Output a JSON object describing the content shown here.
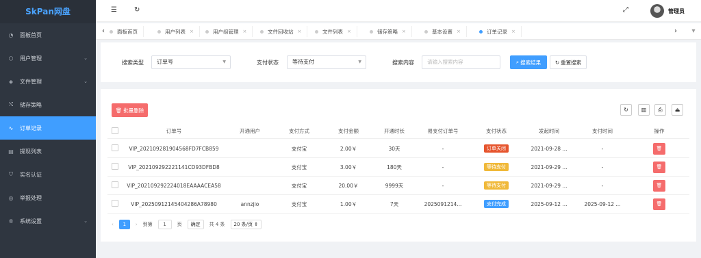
{
  "app": {
    "brand": "SkPan网盘"
  },
  "sidebar": {
    "items": [
      {
        "label": "面板首页",
        "icon": "◔",
        "chevron": ""
      },
      {
        "label": "用户管理",
        "icon": "⬡",
        "chevron": "⌄"
      },
      {
        "label": "文件管理",
        "icon": "◈",
        "chevron": "⌄"
      },
      {
        "label": "储存策略",
        "icon": "⤭",
        "chevron": ""
      },
      {
        "label": "订单记录",
        "icon": "∿",
        "chevron": ""
      },
      {
        "label": "提现列表",
        "icon": "▤",
        "chevron": ""
      },
      {
        "label": "实名认证",
        "icon": "⛉",
        "chevron": ""
      },
      {
        "label": "举报处理",
        "icon": "◎",
        "chevron": ""
      },
      {
        "label": "系统设置",
        "icon": "✲",
        "chevron": "⌄"
      }
    ]
  },
  "header": {
    "menu_icon": "☰",
    "refresh_icon": "↻",
    "fullscreen_icon": "⤢",
    "user_name": "管理员"
  },
  "tabs": {
    "prev": "‹",
    "next": "›",
    "close": "×",
    "items": [
      {
        "label": "面板首页"
      },
      {
        "label": "用户列表"
      },
      {
        "label": "用户组管理"
      },
      {
        "label": "文件回收站"
      },
      {
        "label": "文件列表"
      },
      {
        "label": "储存策略"
      },
      {
        "label": "基本设置"
      },
      {
        "label": "订单记录"
      }
    ]
  },
  "search": {
    "type_label": "搜索类型",
    "type_value": "订单号",
    "status_label": "支付状态",
    "status_value": "等待支付",
    "content_label": "搜索内容",
    "content_placeholder": "请输入搜索内容",
    "search_button": "搜索结果",
    "reset_button": "重置搜索",
    "caret": "▼"
  },
  "toolbar": {
    "batch_delete": "批量删除",
    "tool_icons": [
      "↻",
      "▥",
      "⎙",
      "⏏"
    ]
  },
  "table": {
    "columns": [
      "订单号",
      "开通用户",
      "支付方式",
      "支付金额",
      "开通时长",
      "易支付订单号",
      "支付状态",
      "发起时间",
      "支付时间",
      "操作"
    ],
    "rows": [
      {
        "order_no": "VIP_202109281904568FD7FCB859",
        "user": "",
        "method": "支付宝",
        "amount": "2.00￥",
        "duration": "30天",
        "ext_no": "-",
        "status": "订单关闭",
        "status_color": "#e6552e",
        "created": "2021-09-28 ...",
        "paid": "-"
      },
      {
        "order_no": "VIP_202109292221141CD93DFBD8",
        "user": "",
        "method": "支付宝",
        "amount": "3.00￥",
        "duration": "180天",
        "ext_no": "-",
        "status": "等待支付",
        "status_color": "#f0b93a",
        "created": "2021-09-29 ...",
        "paid": "-"
      },
      {
        "order_no": "VIP_202109292224018EAAAACEA58",
        "user": "",
        "method": "支付宝",
        "amount": "20.00￥",
        "duration": "9999天",
        "ext_no": "-",
        "status": "等待支付",
        "status_color": "#f0b93a",
        "created": "2021-09-29 ...",
        "paid": "-"
      },
      {
        "order_no": "VIP_20250912145404286A78980",
        "user": "annzjio",
        "method": "支付宝",
        "amount": "1.00￥",
        "duration": "7天",
        "ext_no": "2025091214...",
        "status": "支付完成",
        "status_color": "#409eff",
        "created": "2025-09-12 ...",
        "paid": "2025-09-12 ..."
      }
    ],
    "delete_icon": "🗑"
  },
  "pagination": {
    "prev": "‹",
    "current": "1",
    "next": "›",
    "goto_label": "到第",
    "page_input": "1",
    "page_unit": "页",
    "confirm": "确定",
    "total": "共 4 条",
    "page_size": "20 条/页 ⇕"
  }
}
